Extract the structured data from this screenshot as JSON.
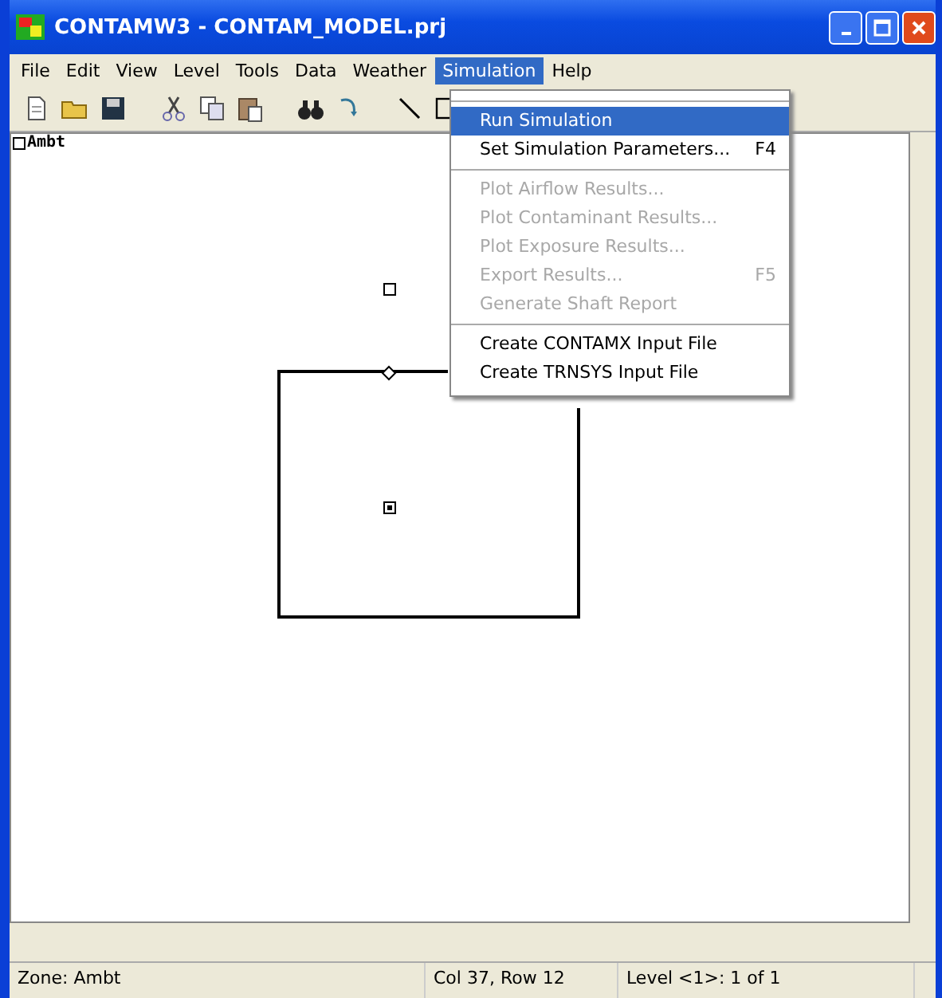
{
  "window": {
    "title": "CONTAMW3 - CONTAM_MODEL.prj"
  },
  "menu_bar": [
    {
      "label": "File",
      "selected": false
    },
    {
      "label": "Edit",
      "selected": false
    },
    {
      "label": "View",
      "selected": false
    },
    {
      "label": "Level",
      "selected": false
    },
    {
      "label": "Tools",
      "selected": false
    },
    {
      "label": "Data",
      "selected": false
    },
    {
      "label": "Weather",
      "selected": false
    },
    {
      "label": "Simulation",
      "selected": true
    },
    {
      "label": "Help",
      "selected": false
    }
  ],
  "dropdown": {
    "groups": [
      [
        {
          "label": "Run Simulation",
          "selected": true,
          "disabled": false
        },
        {
          "label": "Set Simulation Parameters...",
          "shortcut": "F4",
          "selected": false,
          "disabled": false
        }
      ],
      [
        {
          "label": "Plot Airflow Results...",
          "selected": false,
          "disabled": true
        },
        {
          "label": "Plot Contaminant Results...",
          "selected": false,
          "disabled": true
        },
        {
          "label": "Plot Exposure Results...",
          "selected": false,
          "disabled": true
        },
        {
          "label": "Export Results...",
          "shortcut": "F5",
          "selected": false,
          "disabled": true
        },
        {
          "label": "Generate Shaft Report",
          "selected": false,
          "disabled": true
        }
      ],
      [
        {
          "label": "Create CONTAMX Input File",
          "selected": false,
          "disabled": false
        },
        {
          "label": "Create TRNSYS Input File",
          "selected": false,
          "disabled": false
        }
      ]
    ]
  },
  "canvas": {
    "level_label": "Ambt"
  },
  "status_bar": [
    "Zone: Ambt",
    "Col 37, Row 12",
    "Level <1>: 1 of 1"
  ]
}
